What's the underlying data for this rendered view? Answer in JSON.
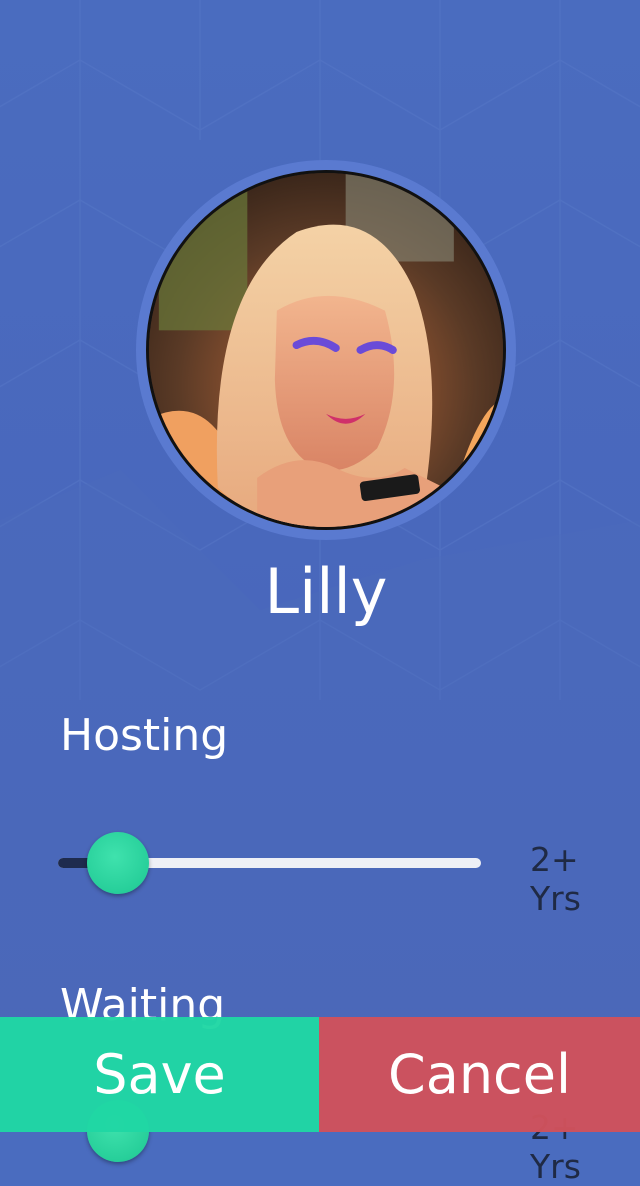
{
  "profile": {
    "name": "Lilly"
  },
  "hosting": {
    "label": "Hosting",
    "value": "2+ Yrs",
    "level": 0.14
  },
  "waiting": {
    "label": "Waiting",
    "value": "2+ Yrs"
  },
  "actions": {
    "save_label": "Save",
    "cancel_label": "Cancel"
  },
  "colors": {
    "background": "#4a6cbf",
    "accent": "#27cf9a",
    "save": "#20d7a4",
    "cancel": "#cf525c"
  }
}
